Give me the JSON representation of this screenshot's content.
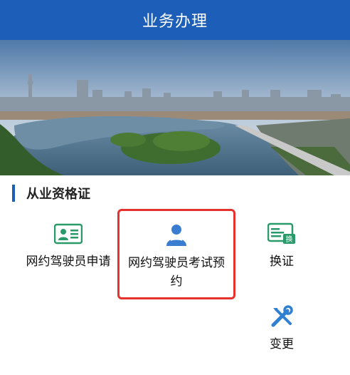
{
  "header": {
    "title": "业务办理"
  },
  "section": {
    "title": "从业资格证"
  },
  "tiles": [
    {
      "label": "网约驾驶员申请",
      "icon": "id-card-icon"
    },
    {
      "label": "网约驾驶员考试预约",
      "icon": "driver-icon"
    },
    {
      "label": "换证",
      "icon": "license-exchange-icon"
    },
    {
      "label": "变更",
      "icon": "tools-icon"
    }
  ],
  "colors": {
    "header": "#1d5fb8",
    "accent": "#1d5fb8",
    "icon_green": "#2a9a6a",
    "highlight_border": "#e5322d"
  }
}
